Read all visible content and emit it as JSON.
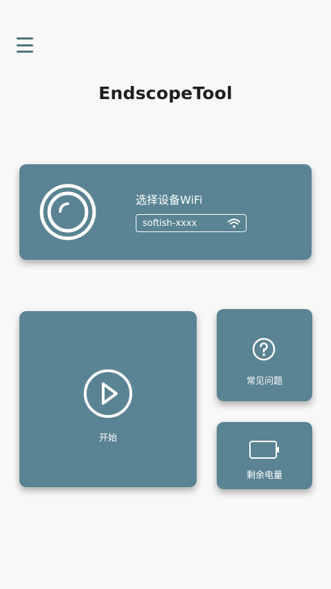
{
  "header": {
    "menu_icon": "hamburger-menu-icon",
    "title": "EndscopeTool"
  },
  "wifi_card": {
    "icon": "camera-lens-icon",
    "heading": "选择设备WiFi",
    "selected_network": "softish-xxxx",
    "status_icon": "wifi-icon"
  },
  "actions": {
    "start": {
      "icon": "play-icon",
      "label": "开始"
    },
    "faq": {
      "icon": "question-icon",
      "label": "常见问题"
    },
    "battery": {
      "icon": "battery-icon",
      "label": "剩余电量"
    }
  },
  "colors": {
    "card_bg": "#5a8393",
    "accent": "#4f707e",
    "page_bg": "#f8f8f8"
  }
}
